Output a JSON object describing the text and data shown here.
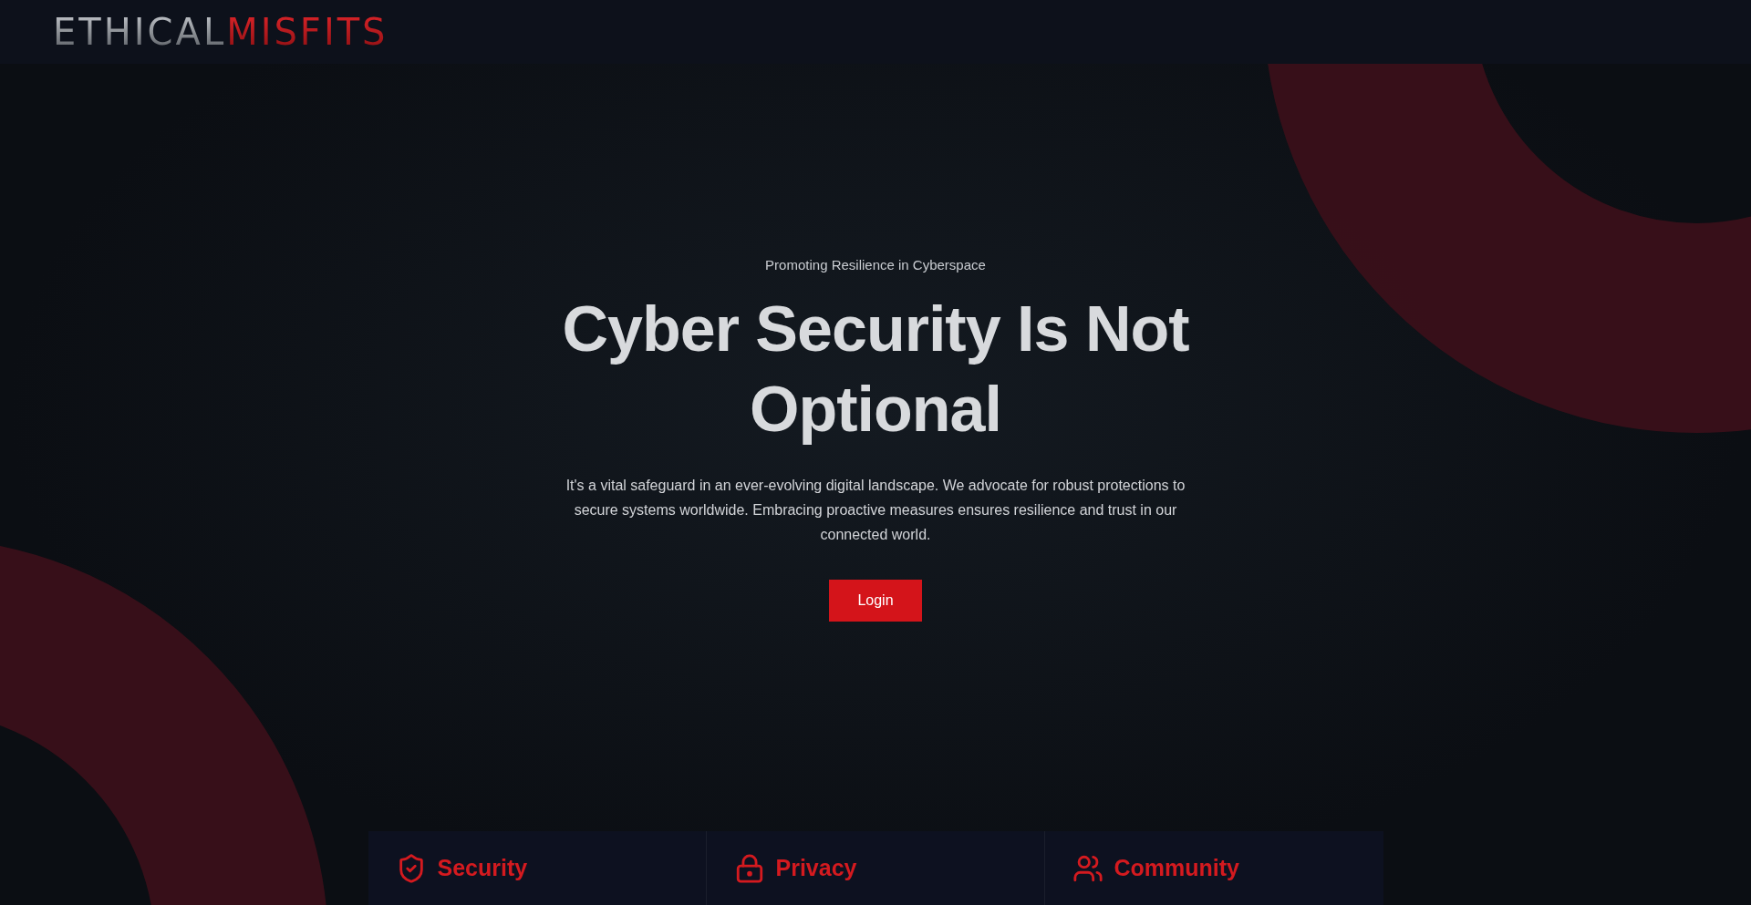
{
  "logo": {
    "first": "ETHICAL",
    "second": "MISFITS"
  },
  "hero": {
    "tagline": "Promoting Resilience in Cyberspace",
    "heading": "Cyber Security Is Not Optional",
    "body": "It's a vital safeguard in an ever-evolving digital landscape. We advocate for robust protections to secure systems worldwide. Embracing proactive measures ensures resilience and trust in our connected world.",
    "button": "Login"
  },
  "features": [
    {
      "kind": "shield",
      "title": "Security"
    },
    {
      "kind": "lock",
      "title": "Privacy"
    },
    {
      "kind": "users",
      "title": "Community"
    }
  ]
}
